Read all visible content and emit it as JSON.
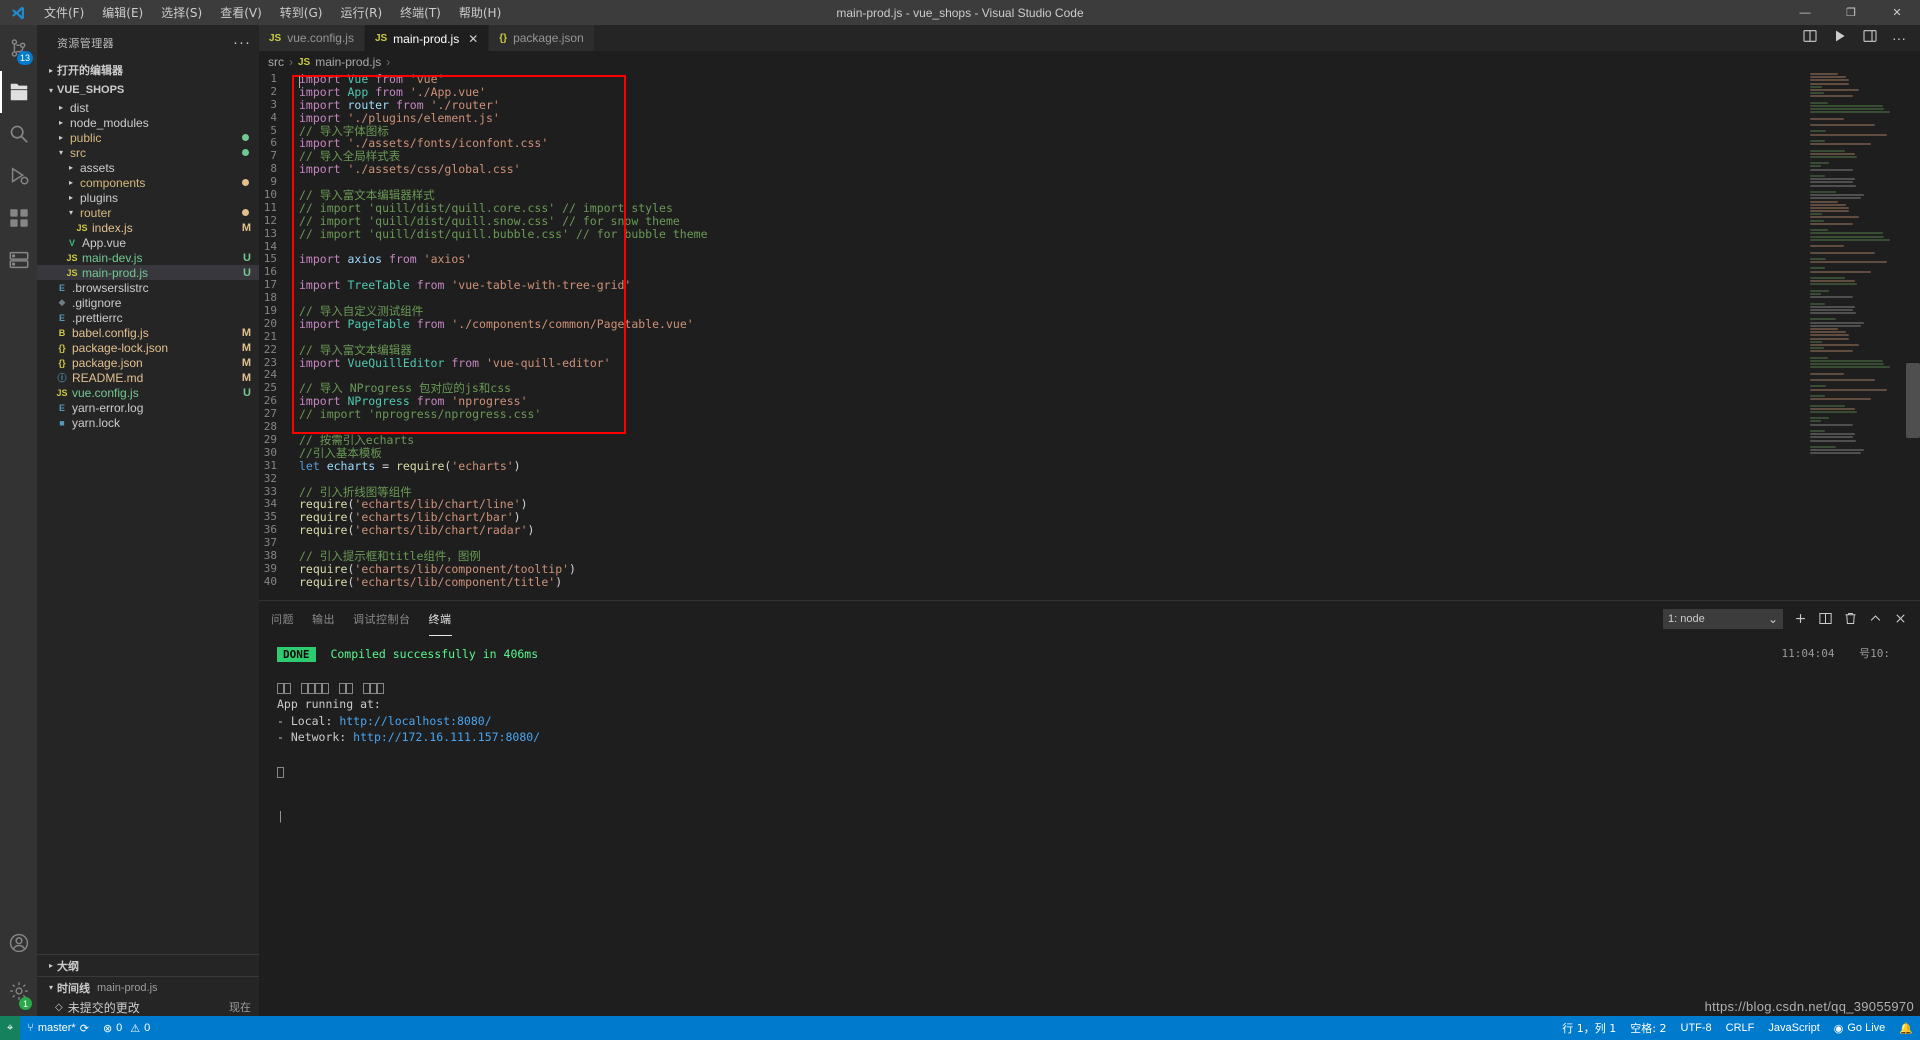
{
  "window": {
    "title": "main-prod.js - vue_shops - Visual Studio Code",
    "minimize": "—",
    "maximize": "❐",
    "close": "✕"
  },
  "menu": [
    {
      "label": "文件(F)",
      "name": "menu-file"
    },
    {
      "label": "编辑(E)",
      "name": "menu-edit"
    },
    {
      "label": "选择(S)",
      "name": "menu-selection"
    },
    {
      "label": "查看(V)",
      "name": "menu-view"
    },
    {
      "label": "转到(G)",
      "name": "menu-go"
    },
    {
      "label": "运行(R)",
      "name": "menu-run"
    },
    {
      "label": "终端(T)",
      "name": "menu-terminal"
    },
    {
      "label": "帮助(H)",
      "name": "menu-help"
    }
  ],
  "activitybar": {
    "scm_badge": "13",
    "settings_badge": "1",
    "items": [
      {
        "name": "explorer-icon",
        "title": "资源管理器"
      },
      {
        "name": "search-icon",
        "title": "搜索"
      },
      {
        "name": "source-control-icon",
        "title": "源代码管理"
      },
      {
        "name": "run-debug-icon",
        "title": "运行和调试"
      },
      {
        "name": "extensions-icon",
        "title": "扩展"
      },
      {
        "name": "remote-explorer-icon",
        "title": "远程资源管理器"
      }
    ]
  },
  "sidebar": {
    "header": "资源管理器",
    "more_actions": "···",
    "open_editors": "打开的编辑器",
    "project": "VUE_SHOPS",
    "tree": [
      {
        "label": "dist",
        "indent": 1,
        "type": "folder",
        "open": false,
        "status": "",
        "icon": ""
      },
      {
        "label": "node_modules",
        "indent": 1,
        "type": "folder",
        "open": false,
        "status": "",
        "icon": ""
      },
      {
        "label": "public",
        "indent": 1,
        "type": "folder",
        "open": false,
        "status": "dot-untracked",
        "icon": ""
      },
      {
        "label": "src",
        "indent": 1,
        "type": "folder",
        "open": true,
        "status": "dot-untracked",
        "icon": ""
      },
      {
        "label": "assets",
        "indent": 2,
        "type": "folder",
        "open": false,
        "status": "",
        "icon": ""
      },
      {
        "label": "components",
        "indent": 2,
        "type": "folder",
        "open": false,
        "status": "dot-modified",
        "icon": ""
      },
      {
        "label": "plugins",
        "indent": 2,
        "type": "folder",
        "open": false,
        "status": "",
        "icon": ""
      },
      {
        "label": "router",
        "indent": 2,
        "type": "folder",
        "open": true,
        "status": "dot-modified",
        "icon": ""
      },
      {
        "label": "index.js",
        "indent": 3,
        "type": "file",
        "open": false,
        "status": "M",
        "icon": "JS"
      },
      {
        "label": "App.vue",
        "indent": 2,
        "type": "file",
        "open": false,
        "status": "",
        "icon": "V"
      },
      {
        "label": "main-dev.js",
        "indent": 2,
        "type": "file",
        "open": false,
        "status": "U",
        "icon": "JS"
      },
      {
        "label": "main-prod.js",
        "indent": 2,
        "type": "file",
        "open": false,
        "status": "U",
        "icon": "JS",
        "selected": true
      },
      {
        "label": ".browserslistrc",
        "indent": 1,
        "type": "file",
        "open": false,
        "status": "",
        "icon": "E"
      },
      {
        "label": ".gitignore",
        "indent": 1,
        "type": "file",
        "open": false,
        "status": "",
        "icon": "◆"
      },
      {
        "label": ".prettierrc",
        "indent": 1,
        "type": "file",
        "open": false,
        "status": "",
        "icon": "E"
      },
      {
        "label": "babel.config.js",
        "indent": 1,
        "type": "file",
        "open": false,
        "status": "M",
        "icon": "B"
      },
      {
        "label": "package-lock.json",
        "indent": 1,
        "type": "file",
        "open": false,
        "status": "M",
        "icon": "{}"
      },
      {
        "label": "package.json",
        "indent": 1,
        "type": "file",
        "open": false,
        "status": "M",
        "icon": "{}"
      },
      {
        "label": "README.md",
        "indent": 1,
        "type": "file",
        "open": false,
        "status": "M",
        "icon": "ⓘ"
      },
      {
        "label": "vue.config.js",
        "indent": 1,
        "type": "file",
        "open": false,
        "status": "U",
        "icon": "JS"
      },
      {
        "label": "yarn-error.log",
        "indent": 1,
        "type": "file",
        "open": false,
        "status": "",
        "icon": "E"
      },
      {
        "label": "yarn.lock",
        "indent": 1,
        "type": "file",
        "open": false,
        "status": "",
        "icon": "■"
      }
    ],
    "outline": "大纲",
    "timeline": "时间线",
    "timeline_file": "main-prod.js",
    "timeline_entry": "未提交的更改",
    "timeline_time": "现在"
  },
  "tabs": [
    {
      "label": "vue.config.js",
      "icon": "JS",
      "active": false,
      "close": ""
    },
    {
      "label": "main-prod.js",
      "icon": "JS",
      "active": true,
      "close": "✕"
    },
    {
      "label": "package.json",
      "icon": "{}",
      "active": false,
      "close": ""
    }
  ],
  "breadcrumb": [
    "src",
    "main-prod.js"
  ],
  "code": {
    "lines": [
      {
        "n": 1,
        "tokens": [
          [
            "kw",
            "import "
          ],
          [
            "id",
            "Vue"
          ],
          [
            "pn",
            " "
          ],
          [
            "kw",
            "from "
          ],
          [
            "str",
            "'vue'"
          ]
        ]
      },
      {
        "n": 2,
        "tokens": [
          [
            "kw",
            "import "
          ],
          [
            "id",
            "App"
          ],
          [
            "pn",
            " "
          ],
          [
            "kw",
            "from "
          ],
          [
            "str",
            "'./App.vue'"
          ]
        ]
      },
      {
        "n": 3,
        "tokens": [
          [
            "kw",
            "import "
          ],
          [
            "var",
            "router"
          ],
          [
            "pn",
            " "
          ],
          [
            "kw",
            "from "
          ],
          [
            "str",
            "'./router'"
          ]
        ]
      },
      {
        "n": 4,
        "tokens": [
          [
            "kw",
            "import "
          ],
          [
            "str",
            "'./plugins/element.js'"
          ]
        ]
      },
      {
        "n": 5,
        "tokens": [
          [
            "cmt",
            "// 导入字体图标"
          ]
        ]
      },
      {
        "n": 6,
        "tokens": [
          [
            "kw",
            "import "
          ],
          [
            "str",
            "'./assets/fonts/iconfont.css'"
          ]
        ]
      },
      {
        "n": 7,
        "tokens": [
          [
            "cmt",
            "// 导入全局样式表"
          ]
        ]
      },
      {
        "n": 8,
        "tokens": [
          [
            "kw",
            "import "
          ],
          [
            "str",
            "'./assets/css/global.css'"
          ]
        ]
      },
      {
        "n": 9,
        "tokens": []
      },
      {
        "n": 10,
        "tokens": [
          [
            "cmt",
            "// 导入富文本编辑器样式"
          ]
        ]
      },
      {
        "n": 11,
        "tokens": [
          [
            "cmt",
            "// import 'quill/dist/quill.core.css' // import styles"
          ]
        ]
      },
      {
        "n": 12,
        "tokens": [
          [
            "cmt",
            "// import 'quill/dist/quill.snow.css' // for snow theme"
          ]
        ]
      },
      {
        "n": 13,
        "tokens": [
          [
            "cmt",
            "// import 'quill/dist/quill.bubble.css' // for bubble theme"
          ]
        ]
      },
      {
        "n": 14,
        "tokens": []
      },
      {
        "n": 15,
        "tokens": [
          [
            "kw",
            "import "
          ],
          [
            "var",
            "axios"
          ],
          [
            "pn",
            " "
          ],
          [
            "kw",
            "from "
          ],
          [
            "str",
            "'axios'"
          ]
        ]
      },
      {
        "n": 16,
        "tokens": []
      },
      {
        "n": 17,
        "tokens": [
          [
            "kw",
            "import "
          ],
          [
            "id",
            "TreeTable"
          ],
          [
            "pn",
            " "
          ],
          [
            "kw",
            "from "
          ],
          [
            "str",
            "'vue-table-with-tree-grid'"
          ]
        ]
      },
      {
        "n": 18,
        "tokens": []
      },
      {
        "n": 19,
        "tokens": [
          [
            "cmt",
            "// 导入自定义测试组件"
          ]
        ]
      },
      {
        "n": 20,
        "tokens": [
          [
            "kw",
            "import "
          ],
          [
            "id",
            "PageTable"
          ],
          [
            "pn",
            " "
          ],
          [
            "kw",
            "from "
          ],
          [
            "str",
            "'./components/common/Pagetable.vue'"
          ]
        ]
      },
      {
        "n": 21,
        "tokens": []
      },
      {
        "n": 22,
        "tokens": [
          [
            "cmt",
            "// 导入富文本编辑器"
          ]
        ]
      },
      {
        "n": 23,
        "tokens": [
          [
            "kw",
            "import "
          ],
          [
            "id",
            "VueQuillEditor"
          ],
          [
            "pn",
            " "
          ],
          [
            "kw",
            "from "
          ],
          [
            "str",
            "'vue-quill-editor'"
          ]
        ]
      },
      {
        "n": 24,
        "tokens": []
      },
      {
        "n": 25,
        "tokens": [
          [
            "cmt",
            "// 导入 NProgress 包对应的js和css"
          ]
        ]
      },
      {
        "n": 26,
        "tokens": [
          [
            "kw",
            "import "
          ],
          [
            "id",
            "NProgress"
          ],
          [
            "pn",
            " "
          ],
          [
            "kw",
            "from "
          ],
          [
            "str",
            "'nprogress'"
          ]
        ]
      },
      {
        "n": 27,
        "tokens": [
          [
            "cmt",
            "// import 'nprogress/nprogress.css'"
          ]
        ]
      },
      {
        "n": 28,
        "tokens": []
      },
      {
        "n": 29,
        "tokens": [
          [
            "cmt",
            "// 按需引入echarts"
          ]
        ]
      },
      {
        "n": 30,
        "tokens": [
          [
            "cmt",
            "//引入基本模板"
          ]
        ]
      },
      {
        "n": 31,
        "tokens": [
          [
            "let",
            "let "
          ],
          [
            "var",
            "echarts"
          ],
          [
            "pn",
            " = "
          ],
          [
            "fn",
            "require"
          ],
          [
            "pn",
            "("
          ],
          [
            "str",
            "'echarts'"
          ],
          [
            "pn",
            ")"
          ]
        ]
      },
      {
        "n": 32,
        "tokens": []
      },
      {
        "n": 33,
        "tokens": [
          [
            "cmt",
            "// 引入折线图等组件"
          ]
        ]
      },
      {
        "n": 34,
        "tokens": [
          [
            "fn",
            "require"
          ],
          [
            "pn",
            "("
          ],
          [
            "str",
            "'echarts/lib/chart/line'"
          ],
          [
            "pn",
            ")"
          ]
        ]
      },
      {
        "n": 35,
        "tokens": [
          [
            "fn",
            "require"
          ],
          [
            "pn",
            "("
          ],
          [
            "str",
            "'echarts/lib/chart/bar'"
          ],
          [
            "pn",
            ")"
          ]
        ]
      },
      {
        "n": 36,
        "tokens": [
          [
            "fn",
            "require"
          ],
          [
            "pn",
            "("
          ],
          [
            "str",
            "'echarts/lib/chart/radar'"
          ],
          [
            "pn",
            ")"
          ]
        ]
      },
      {
        "n": 37,
        "tokens": []
      },
      {
        "n": 38,
        "tokens": [
          [
            "cmt",
            "// 引入提示框和title组件，图例"
          ]
        ]
      },
      {
        "n": 39,
        "tokens": [
          [
            "fn",
            "require"
          ],
          [
            "pn",
            "("
          ],
          [
            "str",
            "'echarts/lib/component/tooltip'"
          ],
          [
            "pn",
            ")"
          ]
        ]
      },
      {
        "n": 40,
        "tokens": [
          [
            "fn",
            "require"
          ],
          [
            "pn",
            "("
          ],
          [
            "str",
            "'echarts/lib/component/title'"
          ],
          [
            "pn",
            ")"
          ]
        ]
      }
    ],
    "highlight_color": "#ff0000"
  },
  "panel": {
    "tabs": [
      {
        "label": "问题",
        "active": false
      },
      {
        "label": "输出",
        "active": false
      },
      {
        "label": "调试控制台",
        "active": false
      },
      {
        "label": "终端",
        "active": true
      }
    ],
    "terminal_select": "1: node",
    "terminal_select_caret": "⌄",
    "actions": {
      "new": "＋",
      "split": "◫",
      "kill": "🗑",
      "maximize": "⌃",
      "close": "✕"
    },
    "output": {
      "done_label": "DONE",
      "done_text": "Compiled successfully in 406ms",
      "timestamp": "11:04:04",
      "timestamp_suffix": "号10:",
      "app_running": "App running at:",
      "local_label": "  - Local:  ",
      "local_url": "http://localhost:8080/",
      "network_label": "  - Network: ",
      "network_url": "http://172.16.111.157:8080/"
    }
  },
  "statusbar": {
    "remote_icon": "⌖",
    "branch": "master*",
    "sync_icon": "⟳",
    "errors": "0",
    "warnings": "0",
    "error_icon": "⊗",
    "warning_icon": "⚠",
    "right": [
      {
        "label": "行 1，列 1",
        "name": "status-line-col"
      },
      {
        "label": "空格: 2",
        "name": "status-indentation"
      },
      {
        "label": "UTF-8",
        "name": "status-encoding"
      },
      {
        "label": "CRLF",
        "name": "status-eol"
      },
      {
        "label": "JavaScript",
        "name": "status-language"
      },
      {
        "label": "Go Live",
        "name": "status-go-live"
      },
      {
        "label": "🔔",
        "name": "status-notifications"
      }
    ]
  },
  "watermark": "https://blog.csdn.net/qq_39055970"
}
